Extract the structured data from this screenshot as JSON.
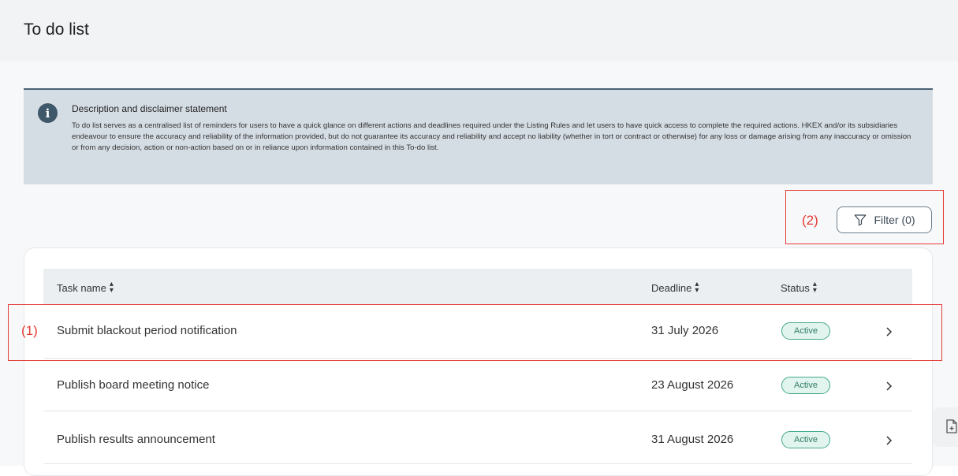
{
  "page": {
    "title": "To do list"
  },
  "disclaimer": {
    "title": "Description and disclaimer statement",
    "text": "To do list serves as a centralised list of reminders for users to have a quick glance on different actions and deadlines required under the Listing Rules and let users to have quick access to complete the required actions. HKEX and/or its subsidiaries endeavour to ensure the accuracy and reliability of the information provided, but do not guarantee its accuracy and reliability and accept no liability (whether in tort or contract or otherwise) for any loss or damage arising from any inaccuracy or omission or from any decision, action or non-action based on or in reliance upon information contained in this To-do list."
  },
  "annotations": {
    "row_label": "(1)",
    "filter_label": "(2)"
  },
  "filter": {
    "label": "Filter (0)"
  },
  "table": {
    "columns": {
      "task": "Task name",
      "deadline": "Deadline",
      "status": "Status"
    },
    "rows": [
      {
        "task": "Submit blackout period notification",
        "deadline": "31 July 2026",
        "status": "Active"
      },
      {
        "task": "Publish board meeting notice",
        "deadline": "23 August 2026",
        "status": "Active"
      },
      {
        "task": "Publish results announcement",
        "deadline": "31 August 2026",
        "status": "Active"
      }
    ]
  },
  "colors": {
    "accent": "#3e5769",
    "annotation": "#e53935",
    "active_badge": "#44a88e"
  },
  "icons": {
    "info": "info-icon",
    "filter": "filter-funnel-icon",
    "sort": "sort-icon",
    "row_action": "chevron-right-icon",
    "side": "document-add-icon"
  }
}
